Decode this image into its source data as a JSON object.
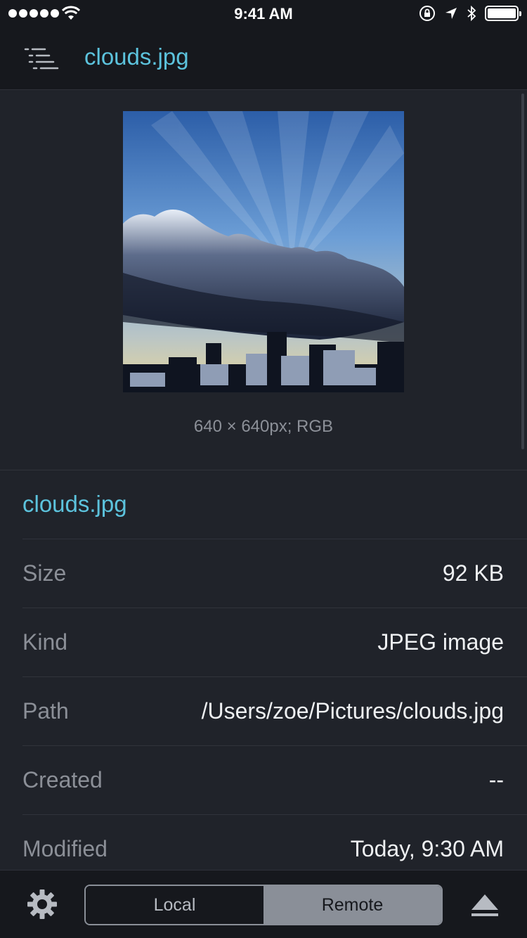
{
  "status_bar": {
    "time": "9:41 AM",
    "signal_dots": 5,
    "icons": [
      "wifi-icon",
      "orientation-lock-icon",
      "location-arrow-icon",
      "bluetooth-icon",
      "battery-icon"
    ]
  },
  "nav": {
    "title": "clouds.jpg",
    "menu_icon": "list-menu-icon"
  },
  "preview": {
    "dimensions_text": "640 × 640px; RGB"
  },
  "details": {
    "file_name": "clouds.jpg",
    "rows": [
      {
        "label": "Size",
        "value": "92 KB"
      },
      {
        "label": "Kind",
        "value": "JPEG image"
      },
      {
        "label": "Path",
        "value": "/Users/zoe/Pictures/clouds.jpg"
      },
      {
        "label": "Created",
        "value": "--"
      },
      {
        "label": "Modified",
        "value": "Today, 9:30 AM"
      }
    ]
  },
  "bottom_bar": {
    "settings_icon": "gear-icon",
    "tabs": [
      {
        "label": "Local",
        "selected": false
      },
      {
        "label": "Remote",
        "selected": true
      }
    ],
    "eject_icon": "eject-icon"
  },
  "colors": {
    "accent": "#5cc3dd",
    "background": "#20232a",
    "bar_background": "#16181d",
    "segment_selected": "#8a8f98"
  }
}
